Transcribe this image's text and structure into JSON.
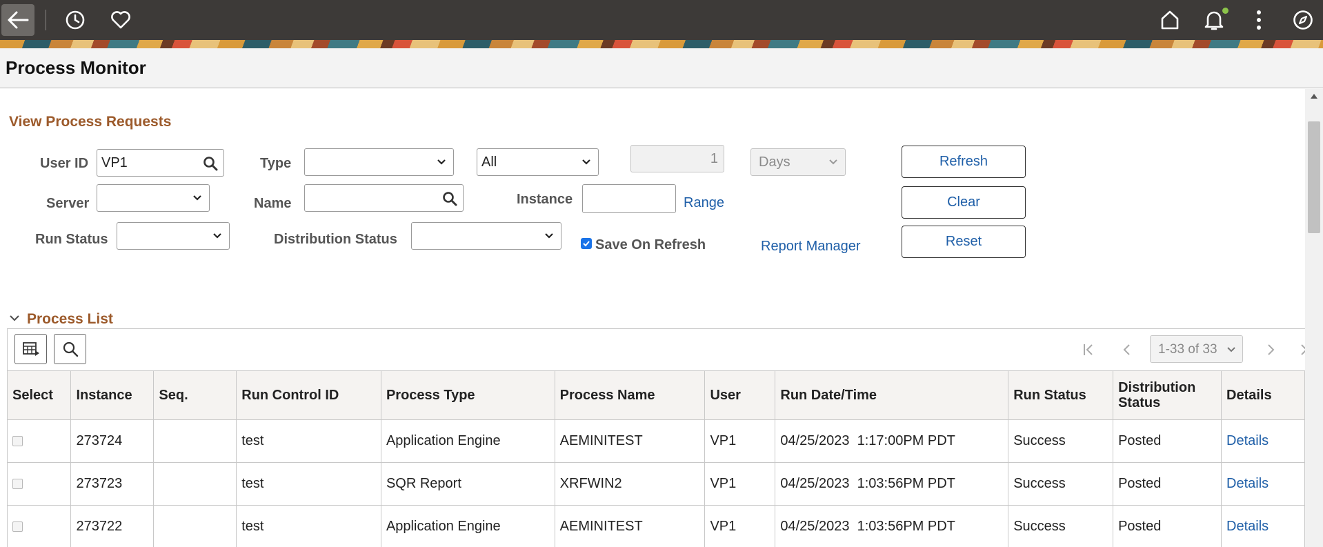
{
  "header": {
    "icons": [
      "back-icon",
      "history-icon",
      "favorites-icon",
      "home-icon",
      "notifications-icon",
      "more-actions-icon",
      "navigator-icon"
    ],
    "notification_dot_color": "#8bc34a"
  },
  "page": {
    "title": "Process Monitor"
  },
  "filters": {
    "section_title": "View Process Requests",
    "user_id_label": "User ID",
    "user_id_value": "VP1",
    "type_label": "Type",
    "type_value": "",
    "range_select_value": "All",
    "range_count_value": "1",
    "range_unit_value": "Days",
    "server_label": "Server",
    "server_value": "",
    "name_label": "Name",
    "name_value": "",
    "instance_label": "Instance",
    "instance_value": "",
    "range_link": "Range",
    "run_status_label": "Run Status",
    "run_status_value": "",
    "dist_status_label": "Distribution Status",
    "dist_status_value": "",
    "save_on_refresh_label": "Save On Refresh",
    "save_on_refresh_checked": true,
    "report_manager_link": "Report Manager",
    "refresh_button": "Refresh",
    "clear_button": "Clear",
    "reset_button": "Reset"
  },
  "process_list": {
    "section_title": "Process List",
    "pager_text": "1-33 of 33",
    "accent_color": "#9c5a2b",
    "link_color": "#1f5fa8",
    "columns": [
      "Select",
      "Instance",
      "Seq.",
      "Run Control ID",
      "Process Type",
      "Process Name",
      "User",
      "Run Date/Time",
      "Run Status",
      "Distribution Status",
      "Details"
    ],
    "rows": [
      {
        "instance": "273724",
        "seq": "",
        "run_control_id": "test",
        "process_type": "Application Engine",
        "process_name": "AEMINITEST",
        "user": "VP1",
        "run_datetime": "04/25/2023  1:17:00PM PDT",
        "run_status": "Success",
        "distribution_status": "Posted",
        "details": "Details"
      },
      {
        "instance": "273723",
        "seq": "",
        "run_control_id": "test",
        "process_type": "SQR Report",
        "process_name": "XRFWIN2",
        "user": "VP1",
        "run_datetime": "04/25/2023  1:03:56PM PDT",
        "run_status": "Success",
        "distribution_status": "Posted",
        "details": "Details"
      },
      {
        "instance": "273722",
        "seq": "",
        "run_control_id": "test",
        "process_type": "Application Engine",
        "process_name": "AEMINITEST",
        "user": "VP1",
        "run_datetime": "04/25/2023  1:03:56PM PDT",
        "run_status": "Success",
        "distribution_status": "Posted",
        "details": "Details"
      }
    ]
  }
}
